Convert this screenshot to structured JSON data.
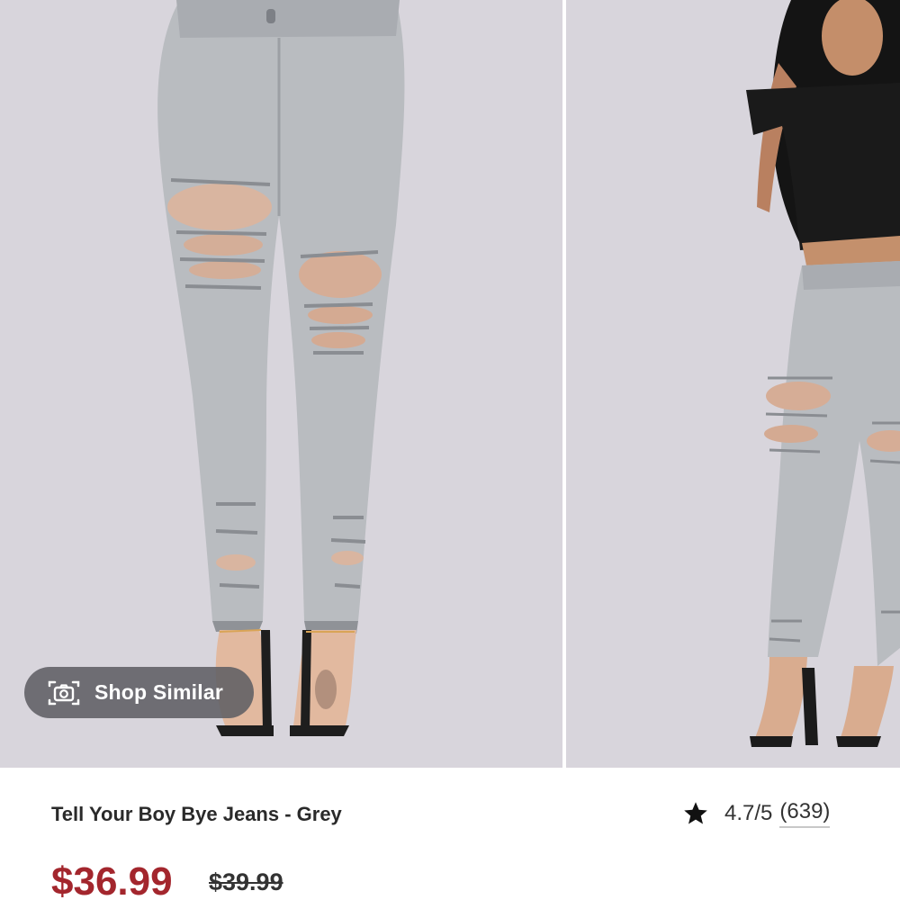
{
  "gallery": {
    "main_image": {
      "alt": "Tell Your Boy Bye Jeans - Grey front view"
    },
    "side_image": {
      "alt": "Tell Your Boy Bye Jeans - Grey full body view"
    }
  },
  "shop_similar": {
    "label": "Shop Similar",
    "icon": "camera-icon"
  },
  "product": {
    "title": "Tell Your Boy Bye Jeans - Grey",
    "rating": {
      "score": "4.7/5",
      "count": "(639)",
      "icon": "star-icon"
    },
    "price": "$36.99",
    "original_price": "$39.99"
  },
  "colors": {
    "price": "#a3262d",
    "background": "#d7d4dc",
    "denim": "#b8bbbf"
  }
}
